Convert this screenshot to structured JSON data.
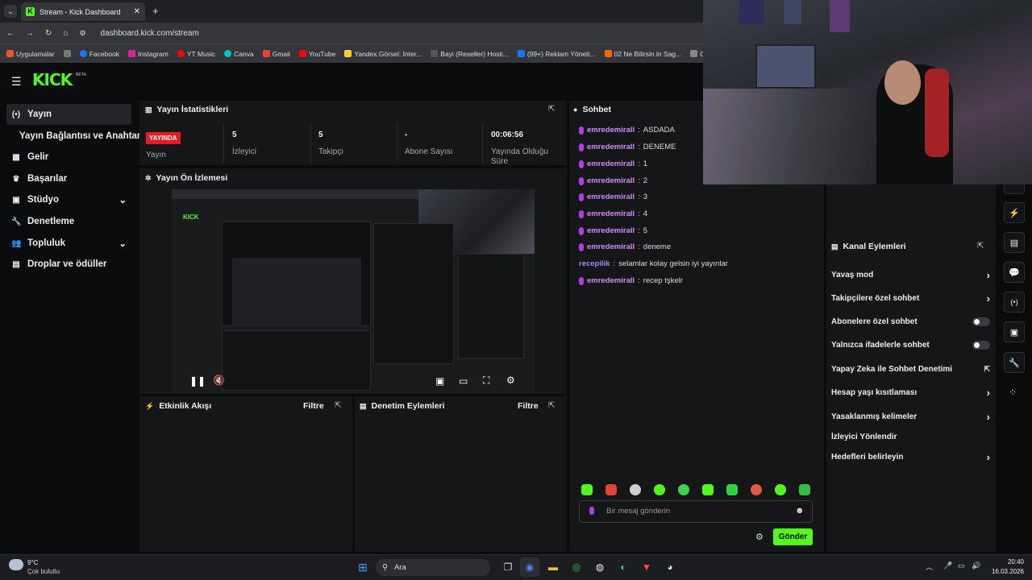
{
  "browser": {
    "tab_title": "Stream - Kick Dashboard",
    "url": "dashboard.kick.com/stream",
    "bookmarks": [
      "Uygulamalar",
      "Facebook",
      "Instagram",
      "YT Music",
      "Canva",
      "Gmail",
      "YouTube",
      "Yandex.Görsel: İnter...",
      "Bayi (Reseller) Hosti...",
      "(99+) Reklam Yöneti...",
      "02 Ne Bilirsin in Sag...",
      "Ch"
    ]
  },
  "header": {
    "logo": "KICK",
    "badge": "BETA"
  },
  "sidebar": {
    "items": [
      {
        "label": "Yayın",
        "icon": "broadcast-icon"
      },
      {
        "label": "Yayın Bağlantısı ve Anahtarı",
        "icon": ""
      },
      {
        "label": "Gelir",
        "icon": "bank-icon"
      },
      {
        "label": "Başarılar",
        "icon": "trophy-icon"
      },
      {
        "label": "Stüdyo",
        "icon": "film-icon"
      },
      {
        "label": "Denetleme",
        "icon": "wrench-icon"
      },
      {
        "label": "Topluluk",
        "icon": "people-icon"
      },
      {
        "label": "Droplar ve ödüller",
        "icon": "gift-icon"
      }
    ]
  },
  "stats": {
    "title": "Yayın İstatistikleri",
    "live_badge": "YAYINDA",
    "items": [
      {
        "value": "",
        "label": "Yayın"
      },
      {
        "value": "5",
        "label": "İzleyici"
      },
      {
        "value": "5",
        "label": "Takipçi"
      },
      {
        "value": "-",
        "label": "Abone Sayısı"
      },
      {
        "value": "00:06:56",
        "label": "Yayında Olduğu Süre"
      }
    ]
  },
  "preview": {
    "title": "Yayın Ön İzlemesi"
  },
  "activity": {
    "title": "Etkinlik Akışı",
    "filter": "Filtre"
  },
  "moderation": {
    "title": "Denetim Eylemleri",
    "filter": "Filtre"
  },
  "chat": {
    "title": "Sohbet",
    "messages": [
      {
        "user": "emredemirall",
        "text": " ASDADA"
      },
      {
        "user": "emredemirall",
        "text": " DENEME"
      },
      {
        "user": "emredemirall",
        "text": " 1"
      },
      {
        "user": "emredemirall",
        "text": " 2"
      },
      {
        "user": "emredemirall",
        "text": " 3"
      },
      {
        "user": "emredemirall",
        "text": " 4"
      },
      {
        "user": "emredemirall",
        "text": " 5"
      },
      {
        "user": "emredemirall",
        "text": " deneme"
      },
      {
        "user": "recepilik",
        "text": " selamlar kolay gelsin iyi yayınlar"
      },
      {
        "user": "emredemirall",
        "text": " recep tşkelr"
      }
    ],
    "placeholder": "Bir mesaj gönderin",
    "send": "Gönder"
  },
  "channel_actions": {
    "title": "Kanal Eylemleri",
    "items": [
      {
        "label": "Yavaş mod",
        "control": "chevron"
      },
      {
        "label": "Takipçilere özel sohbet",
        "control": "chevron"
      },
      {
        "label": "Abonelere özel sohbet",
        "control": "toggle"
      },
      {
        "label": "Yalnızca ifadelerle sohbet",
        "control": "toggle"
      },
      {
        "label": "Yapay Zeka ile Sohbet Denetimi",
        "control": "external"
      },
      {
        "label": "Hesap yaşı kısıtlaması",
        "control": "chevron"
      },
      {
        "label": "Yasaklanmış kelimeler",
        "control": "chevron"
      },
      {
        "label": "İzleyici Yönlendir",
        "control": ""
      },
      {
        "label": "Hedefleri belirleyin",
        "control": "chevron"
      }
    ]
  },
  "taskbar": {
    "weather_temp": "9°C",
    "weather_desc": "Çok bulutlu",
    "search": "Ara",
    "time": "20:40",
    "date": "16.03.2026"
  },
  "colors": {
    "brand": "#53fc18",
    "live": "#e31b23",
    "chat_user": "#d28cf3"
  }
}
